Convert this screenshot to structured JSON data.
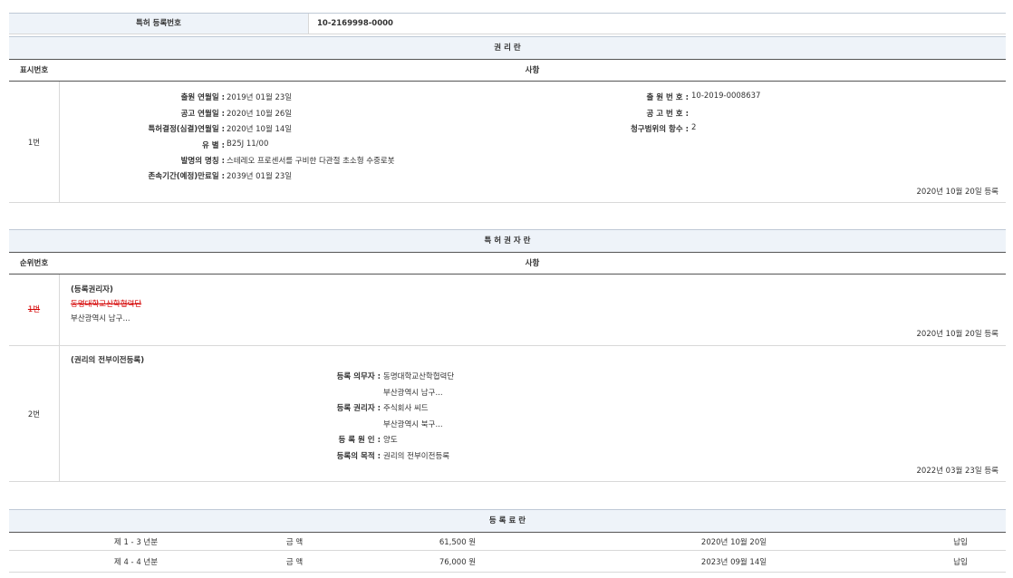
{
  "top": {
    "label": "특허 등록번호",
    "value": "10-2169998-0000"
  },
  "rights": {
    "title": "권 리 란",
    "col1": "표시번호",
    "col2": "사항",
    "rowno": "1번",
    "left": [
      {
        "label": "출원 연월일 :",
        "value": "2019년 01월 23일"
      },
      {
        "label": "공고 연월일 :",
        "value": "2020년 10월 26일"
      },
      {
        "label": "특허결정(심결)연월일 :",
        "value": "2020년 10월 14일"
      },
      {
        "label": "유 별 :",
        "value": "B25J 11/00"
      },
      {
        "label": "발명의 명칭 :",
        "value": "스테레오 프로센서를 구비한 다관절 초소형 수중로봇"
      },
      {
        "label": "존속기간(예정)만료일 :",
        "value": "2039년 01월 23일"
      }
    ],
    "right": [
      {
        "label": "출 원 번 호 :",
        "value": "10-2019-0008637"
      },
      {
        "label": "공 고 번 호 :",
        "value": ""
      },
      {
        "label": "청구범위의 항수 :",
        "value": "2"
      }
    ],
    "date": "2020년 10월 20일 등록"
  },
  "holders": {
    "title": "특 허 권 자 란",
    "col1": "순위번호",
    "col2": "사항",
    "row1": {
      "no": "1번",
      "type": "(등록권리자)",
      "name": "동명대학교산학협력단",
      "addr": "부산광역시 남구...",
      "date": "2020년 10월 20일 등록"
    },
    "row2": {
      "no": "2번",
      "type": "(권리의 전부이전등록)",
      "items": [
        {
          "label": "등록 의무자 :",
          "value": "동명대학교산학협력단"
        },
        {
          "label": "",
          "value": "부산광역시 남구..."
        },
        {
          "label": "등록 권리자 :",
          "value": "주식회사 씨드"
        },
        {
          "label": "",
          "value": "부산광역시 북구..."
        },
        {
          "label": "등 록 원 인 :",
          "value": "양도"
        },
        {
          "label": "등록의 목적 :",
          "value": "권리의 전부이전등록"
        }
      ],
      "date": "2022년 03월 23일 등록"
    }
  },
  "fees": {
    "title": "등 록 료 란",
    "rows": [
      {
        "period": "제 1 - 3 년분",
        "kind": "금 액",
        "amount": "61,500 원",
        "date": "2020년 10월 20일",
        "status": "납입"
      },
      {
        "period": "제 4 - 4 년분",
        "kind": "금 액",
        "amount": "76,000 원",
        "date": "2023년 09월 14일",
        "status": "납입"
      }
    ]
  }
}
